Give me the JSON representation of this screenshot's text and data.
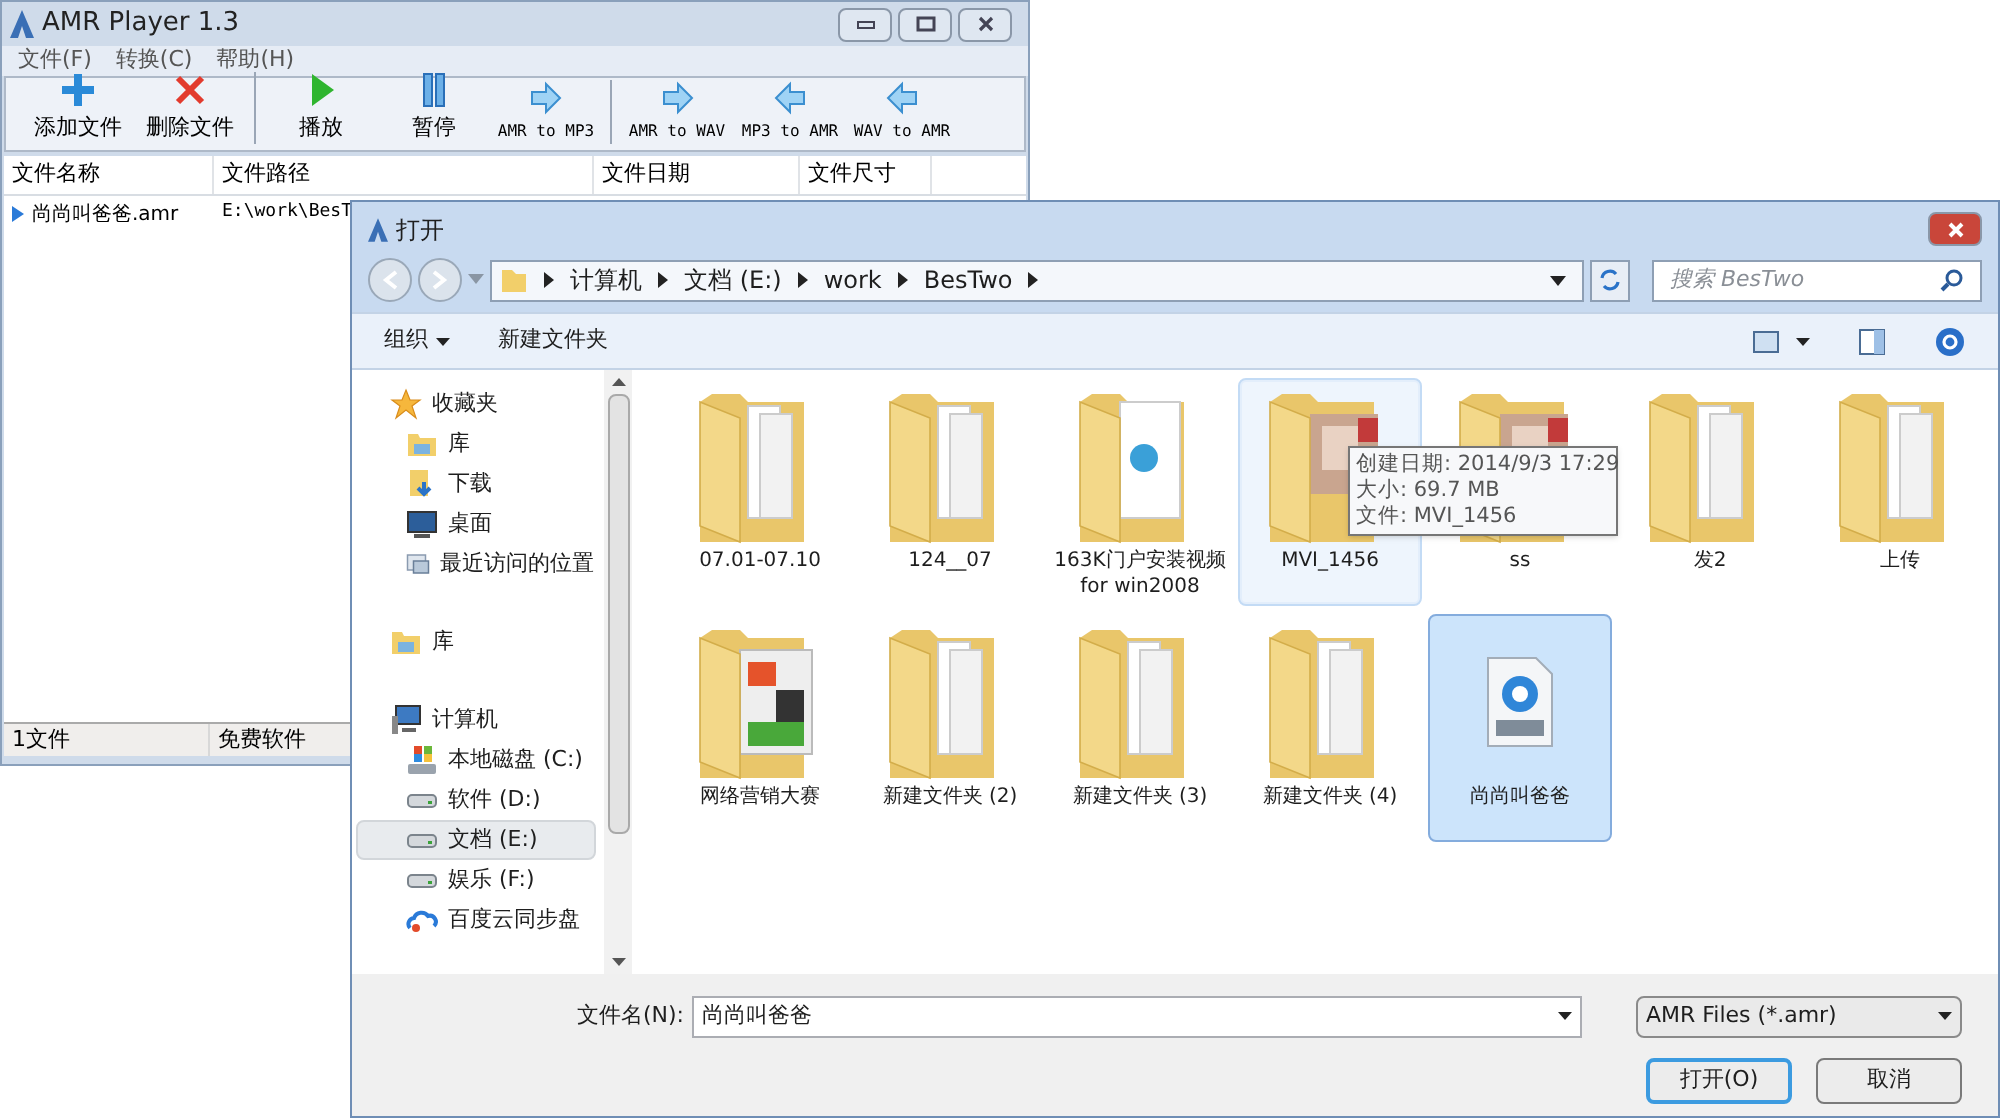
{
  "player": {
    "title": "AMR Player 1.3",
    "menu": [
      "文件(F)",
      "转换(C)",
      "帮助(H)"
    ],
    "toolbar": [
      {
        "label": "添加文件",
        "kind": "add",
        "separator_before": false
      },
      {
        "label": "删除文件",
        "kind": "delete",
        "separator_before": false
      },
      {
        "label": "播放",
        "kind": "play",
        "separator_before": true
      },
      {
        "label": "暂停",
        "kind": "pause",
        "separator_before": false
      },
      {
        "label": "AMR to MP3",
        "kind": "to-right",
        "separator_before": false
      },
      {
        "label": "AMR to WAV",
        "kind": "to-right",
        "separator_before": true
      },
      {
        "label": "MP3 to AMR",
        "kind": "to-left",
        "separator_before": false
      },
      {
        "label": "WAV to AMR",
        "kind": "to-left",
        "separator_before": false
      }
    ],
    "columns": [
      "文件名称",
      "文件路径",
      "文件日期",
      "文件尺寸"
    ],
    "rows": [
      {
        "name": "尚尚叫爸爸.amr",
        "path": "E:\\work\\BesT"
      }
    ],
    "status": [
      "1文件",
      "免费软件"
    ]
  },
  "dialog": {
    "title": "打开",
    "breadcrumb": [
      "计算机",
      "文档 (E:)",
      "work",
      "BesTwo"
    ],
    "search": {
      "placeholder": "搜索 BesTwo"
    },
    "toolbar": [
      {
        "label": "组织",
        "dropdown": true
      },
      {
        "label": "新建文件夹",
        "dropdown": false
      }
    ],
    "nav": [
      {
        "label": "收藏夹",
        "kind": "star",
        "selected": false,
        "children": [
          {
            "label": "库",
            "kind": "library",
            "selected": false
          },
          {
            "label": "下载",
            "kind": "download",
            "selected": false
          },
          {
            "label": "桌面",
            "kind": "desktop",
            "selected": false
          },
          {
            "label": "最近访问的位置",
            "kind": "recent",
            "selected": false
          }
        ]
      },
      {
        "label": "库",
        "kind": "library",
        "selected": false
      },
      {
        "label": "计算机",
        "kind": "computer",
        "selected": false,
        "children": [
          {
            "label": "本地磁盘 (C:)",
            "kind": "system-drive",
            "selected": false
          },
          {
            "label": "软件 (D:)",
            "kind": "drive",
            "selected": false
          },
          {
            "label": "文档 (E:)",
            "kind": "drive",
            "selected": true
          },
          {
            "label": "娱乐 (F:)",
            "kind": "drive",
            "selected": false
          },
          {
            "label": "百度云同步盘",
            "kind": "cloud",
            "selected": false
          }
        ]
      }
    ],
    "files": [
      {
        "name": "07.01-07.10",
        "kind": "folder",
        "selected": false,
        "hovered": false
      },
      {
        "name": "124__07",
        "kind": "folder",
        "selected": false,
        "hovered": false
      },
      {
        "name": "163K门户安装视频 for win2008",
        "kind": "doc-folder",
        "selected": false,
        "hovered": false
      },
      {
        "name": "MVI_1456",
        "kind": "photo-folder",
        "selected": false,
        "hovered": true
      },
      {
        "name": "ss",
        "kind": "photo-folder",
        "selected": false,
        "hovered": false
      },
      {
        "name": "发2",
        "kind": "folder",
        "selected": false,
        "hovered": false
      },
      {
        "name": "上传",
        "kind": "folder",
        "selected": false,
        "hovered": false
      },
      {
        "name": "网络营销大赛",
        "kind": "poster-folder",
        "selected": false,
        "hovered": false
      },
      {
        "name": "新建文件夹 (2)",
        "kind": "folder",
        "selected": false,
        "hovered": false
      },
      {
        "name": "新建文件夹 (3)",
        "kind": "folder",
        "selected": false,
        "hovered": false
      },
      {
        "name": "新建文件夹 (4)",
        "kind": "folder",
        "selected": false,
        "hovered": false
      },
      {
        "name": "尚尚叫爸爸",
        "kind": "video",
        "selected": true,
        "hovered": false
      }
    ],
    "tooltip": [
      "创建日期: 2014/9/3 17:29",
      "大小: 69.7 MB",
      "文件: MVI_1456"
    ],
    "filename_label": "文件名(N):",
    "filename": "尚尚叫爸爸",
    "filter": "AMR Files (*.amr)",
    "buttons": [
      {
        "label": "打开(O)",
        "default": true
      },
      {
        "label": "取消",
        "default": false
      }
    ]
  }
}
